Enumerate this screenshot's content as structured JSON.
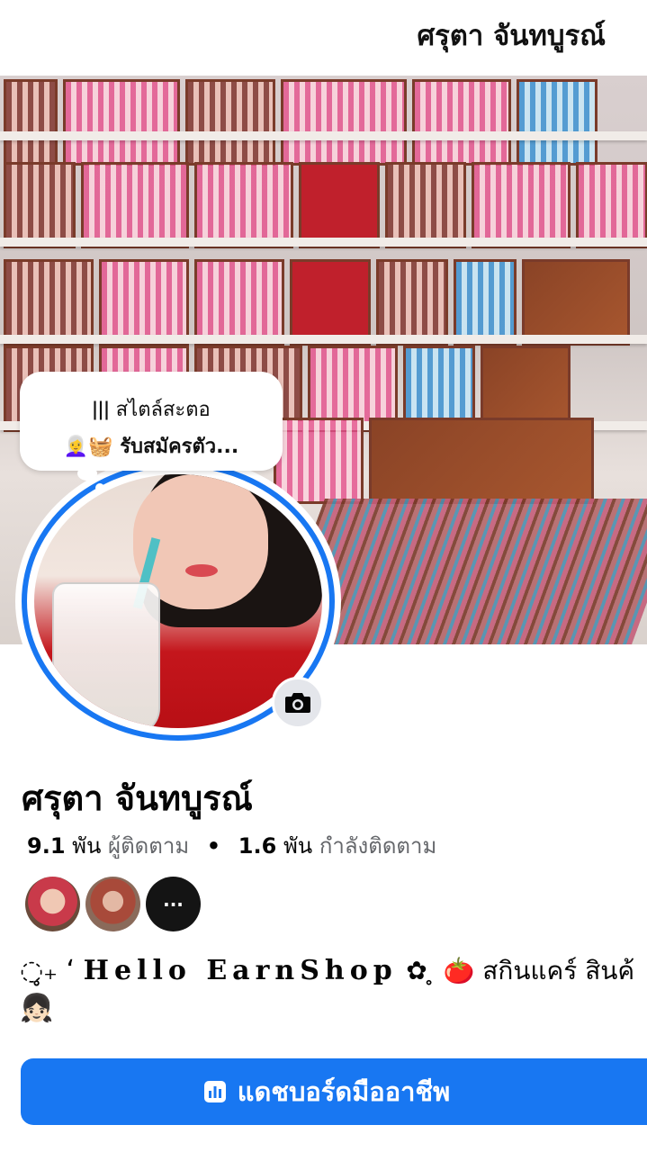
{
  "header": {
    "title": "ศรุตา จันทบูรณ์"
  },
  "cover": {
    "description_icon": "cover-photo"
  },
  "note_bubble": {
    "line1": "ǀǀǀ สไตล์สะตอ",
    "line2": "👩‍🦳🧺 รับสมัครตัว..."
  },
  "profile": {
    "name": "ศรุตา จันทบูรณ์",
    "followers_count": "9.1",
    "followers_unit": "พัน",
    "followers_label": "ผู้ติดตาม",
    "separator": "•",
    "following_count": "1.6",
    "following_unit": "พัน",
    "following_label": "กำลังติดตาม"
  },
  "friends": {
    "more_label": "···"
  },
  "bio": {
    "prefix": "◌̥₊ ʻ",
    "brand": "Hello EarnShop",
    "suffix": "✿ ̥ 🍅 สกินแคร์ สินค้",
    "line2": "👧🏻"
  },
  "dashboard_button": {
    "label": "แดชบอร์ดมืออาชีพ",
    "icon": "dashboard-icon"
  },
  "colors": {
    "accent": "#1877f2",
    "secondary_text": "#65676b"
  }
}
